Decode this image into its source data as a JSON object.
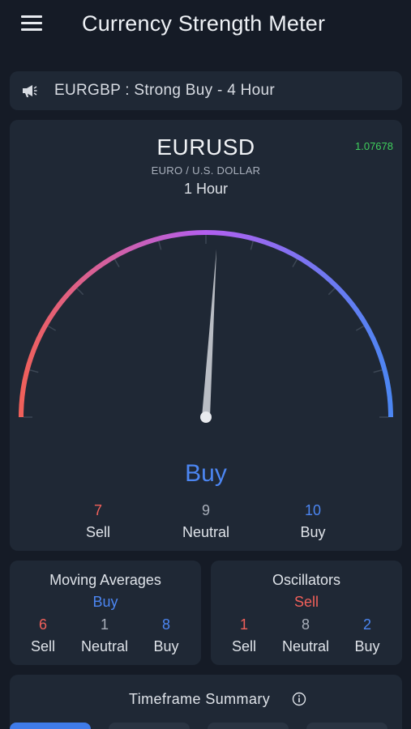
{
  "app_bar": {
    "title": "Currency Strength Meter"
  },
  "banner": {
    "text": "EURGBP : Strong Buy - 4 Hour",
    "icon": "megaphone-icon"
  },
  "gauge": {
    "pair": "EURUSD",
    "price": "1.07678",
    "description": "EURO / U.S. DOLLAR",
    "timeframe": "1 Hour",
    "verdict": "Buy",
    "needle_level": 0.52,
    "counts": [
      {
        "value": "7",
        "label": "Sell"
      },
      {
        "value": "9",
        "label": "Neutral"
      },
      {
        "value": "10",
        "label": "Buy"
      }
    ]
  },
  "moving_averages": {
    "title": "Moving Averages",
    "verdict": "Buy",
    "counts": [
      {
        "value": "6",
        "label": "Sell"
      },
      {
        "value": "1",
        "label": "Neutral"
      },
      {
        "value": "8",
        "label": "Buy"
      }
    ]
  },
  "oscillators": {
    "title": "Oscillators",
    "verdict": "Sell",
    "counts": [
      {
        "value": "1",
        "label": "Sell"
      },
      {
        "value": "8",
        "label": "Neutral"
      },
      {
        "value": "2",
        "label": "Buy"
      }
    ]
  },
  "timeframe_summary": {
    "title": "Timeframe Summary",
    "icon": "info-icon"
  },
  "colors": {
    "background": "#151b26",
    "card": "#1f2835",
    "sell": "#f0605a",
    "neutral": "#a8aeb9",
    "buy": "#4c86f2",
    "price": "#3fcf5c",
    "gauge_start": "#f0605a",
    "gauge_mid": "#b35ff0",
    "gauge_end": "#4c86f2"
  }
}
